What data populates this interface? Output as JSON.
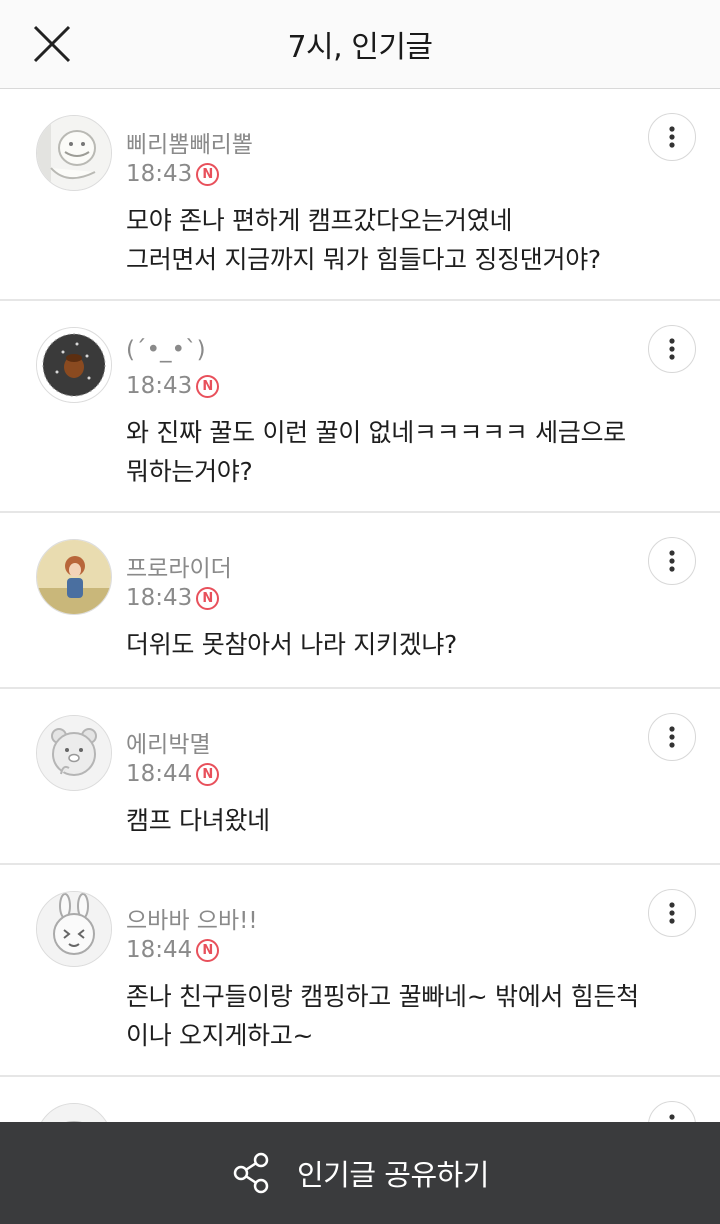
{
  "header": {
    "title": "7시, 인기글",
    "close_icon": "close-x-icon"
  },
  "comments": [
    {
      "nickname": "삐리뽐빼리뽈",
      "time": "18:43",
      "badge": "N",
      "text": "모야 존나 편하게 캠프갔다오는거였네\n그러면서 지금까지 뭐가 힘들다고 징징댄거야?"
    },
    {
      "nickname": "(´•_•`)",
      "time": "18:43",
      "badge": "N",
      "text": "와 진짜 꿀도 이런 꿀이 없네ㅋㅋㅋㅋㅋ 세금으로\n뭐하는거야?"
    },
    {
      "nickname": "프로라이더",
      "time": "18:43",
      "badge": "N",
      "text": "더위도 못참아서 나라 지키겠냐?"
    },
    {
      "nickname": "에리박멸",
      "time": "18:44",
      "badge": "N",
      "text": "캠프 다녀왔네"
    },
    {
      "nickname": "으바바 으바!!",
      "time": "18:44",
      "badge": "N",
      "text": "존나 친구들이랑 캠핑하고 꿀빠네~ 밖에서 힘든척\n이나 오지게하고~"
    },
    {
      "nickname": "",
      "time": "",
      "badge": "",
      "text": ""
    }
  ],
  "bottom_bar": {
    "label": "인기글 공유하기",
    "icon": "share-icon",
    "background": "#3a3b3d"
  },
  "colors": {
    "badge": "#e8505b",
    "meta_text": "#8a8a8a"
  }
}
